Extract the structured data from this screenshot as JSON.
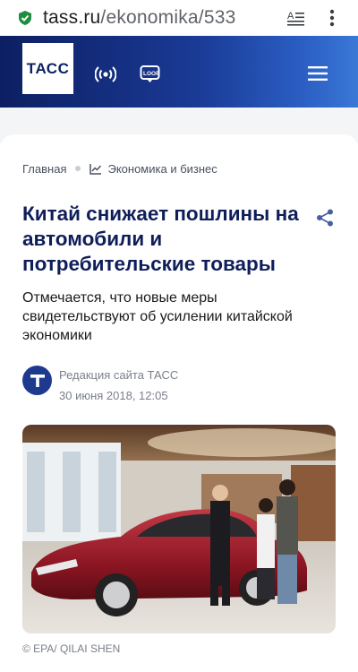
{
  "browser": {
    "url_host": "tass.ru",
    "url_path": "/ekonomika/533"
  },
  "header": {
    "logo_text": "ТАСС"
  },
  "breadcrumb": {
    "home": "Главная",
    "section": "Экономика и бизнес"
  },
  "article": {
    "title": "Китай снижает пошлины на автомобили и потребительские товары",
    "lead": "Отмечается, что новые меры свидетельствуют об усилении китайской экономики",
    "author": "Редакция сайта ТАСС",
    "date": "30 июня 2018, 12:05",
    "photo_credit": "© EPA/ QILAI SHEN",
    "avatar_letter": "T"
  },
  "colors": {
    "brand_navy": "#0f1e5a",
    "header_start": "#0d1f62",
    "header_end": "#3a78d6",
    "secure_green": "#1e8e3e"
  }
}
